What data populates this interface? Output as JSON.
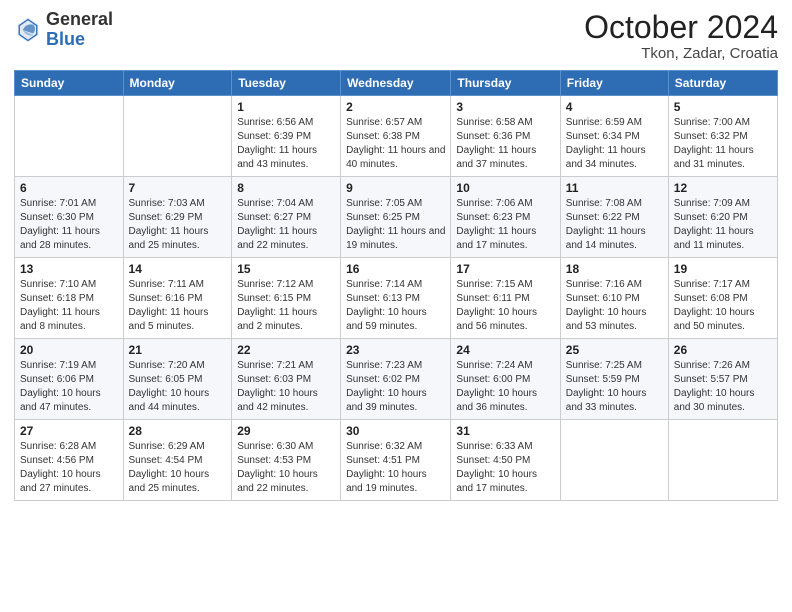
{
  "header": {
    "logo_general": "General",
    "logo_blue": "Blue",
    "month_title": "October 2024",
    "location": "Tkon, Zadar, Croatia"
  },
  "weekdays": [
    "Sunday",
    "Monday",
    "Tuesday",
    "Wednesday",
    "Thursday",
    "Friday",
    "Saturday"
  ],
  "weeks": [
    [
      {
        "day": "",
        "info": ""
      },
      {
        "day": "",
        "info": ""
      },
      {
        "day": "1",
        "info": "Sunrise: 6:56 AM\nSunset: 6:39 PM\nDaylight: 11 hours and 43 minutes."
      },
      {
        "day": "2",
        "info": "Sunrise: 6:57 AM\nSunset: 6:38 PM\nDaylight: 11 hours and 40 minutes."
      },
      {
        "day": "3",
        "info": "Sunrise: 6:58 AM\nSunset: 6:36 PM\nDaylight: 11 hours and 37 minutes."
      },
      {
        "day": "4",
        "info": "Sunrise: 6:59 AM\nSunset: 6:34 PM\nDaylight: 11 hours and 34 minutes."
      },
      {
        "day": "5",
        "info": "Sunrise: 7:00 AM\nSunset: 6:32 PM\nDaylight: 11 hours and 31 minutes."
      }
    ],
    [
      {
        "day": "6",
        "info": "Sunrise: 7:01 AM\nSunset: 6:30 PM\nDaylight: 11 hours and 28 minutes."
      },
      {
        "day": "7",
        "info": "Sunrise: 7:03 AM\nSunset: 6:29 PM\nDaylight: 11 hours and 25 minutes."
      },
      {
        "day": "8",
        "info": "Sunrise: 7:04 AM\nSunset: 6:27 PM\nDaylight: 11 hours and 22 minutes."
      },
      {
        "day": "9",
        "info": "Sunrise: 7:05 AM\nSunset: 6:25 PM\nDaylight: 11 hours and 19 minutes."
      },
      {
        "day": "10",
        "info": "Sunrise: 7:06 AM\nSunset: 6:23 PM\nDaylight: 11 hours and 17 minutes."
      },
      {
        "day": "11",
        "info": "Sunrise: 7:08 AM\nSunset: 6:22 PM\nDaylight: 11 hours and 14 minutes."
      },
      {
        "day": "12",
        "info": "Sunrise: 7:09 AM\nSunset: 6:20 PM\nDaylight: 11 hours and 11 minutes."
      }
    ],
    [
      {
        "day": "13",
        "info": "Sunrise: 7:10 AM\nSunset: 6:18 PM\nDaylight: 11 hours and 8 minutes."
      },
      {
        "day": "14",
        "info": "Sunrise: 7:11 AM\nSunset: 6:16 PM\nDaylight: 11 hours and 5 minutes."
      },
      {
        "day": "15",
        "info": "Sunrise: 7:12 AM\nSunset: 6:15 PM\nDaylight: 11 hours and 2 minutes."
      },
      {
        "day": "16",
        "info": "Sunrise: 7:14 AM\nSunset: 6:13 PM\nDaylight: 10 hours and 59 minutes."
      },
      {
        "day": "17",
        "info": "Sunrise: 7:15 AM\nSunset: 6:11 PM\nDaylight: 10 hours and 56 minutes."
      },
      {
        "day": "18",
        "info": "Sunrise: 7:16 AM\nSunset: 6:10 PM\nDaylight: 10 hours and 53 minutes."
      },
      {
        "day": "19",
        "info": "Sunrise: 7:17 AM\nSunset: 6:08 PM\nDaylight: 10 hours and 50 minutes."
      }
    ],
    [
      {
        "day": "20",
        "info": "Sunrise: 7:19 AM\nSunset: 6:06 PM\nDaylight: 10 hours and 47 minutes."
      },
      {
        "day": "21",
        "info": "Sunrise: 7:20 AM\nSunset: 6:05 PM\nDaylight: 10 hours and 44 minutes."
      },
      {
        "day": "22",
        "info": "Sunrise: 7:21 AM\nSunset: 6:03 PM\nDaylight: 10 hours and 42 minutes."
      },
      {
        "day": "23",
        "info": "Sunrise: 7:23 AM\nSunset: 6:02 PM\nDaylight: 10 hours and 39 minutes."
      },
      {
        "day": "24",
        "info": "Sunrise: 7:24 AM\nSunset: 6:00 PM\nDaylight: 10 hours and 36 minutes."
      },
      {
        "day": "25",
        "info": "Sunrise: 7:25 AM\nSunset: 5:59 PM\nDaylight: 10 hours and 33 minutes."
      },
      {
        "day": "26",
        "info": "Sunrise: 7:26 AM\nSunset: 5:57 PM\nDaylight: 10 hours and 30 minutes."
      }
    ],
    [
      {
        "day": "27",
        "info": "Sunrise: 6:28 AM\nSunset: 4:56 PM\nDaylight: 10 hours and 27 minutes."
      },
      {
        "day": "28",
        "info": "Sunrise: 6:29 AM\nSunset: 4:54 PM\nDaylight: 10 hours and 25 minutes."
      },
      {
        "day": "29",
        "info": "Sunrise: 6:30 AM\nSunset: 4:53 PM\nDaylight: 10 hours and 22 minutes."
      },
      {
        "day": "30",
        "info": "Sunrise: 6:32 AM\nSunset: 4:51 PM\nDaylight: 10 hours and 19 minutes."
      },
      {
        "day": "31",
        "info": "Sunrise: 6:33 AM\nSunset: 4:50 PM\nDaylight: 10 hours and 17 minutes."
      },
      {
        "day": "",
        "info": ""
      },
      {
        "day": "",
        "info": ""
      }
    ]
  ]
}
